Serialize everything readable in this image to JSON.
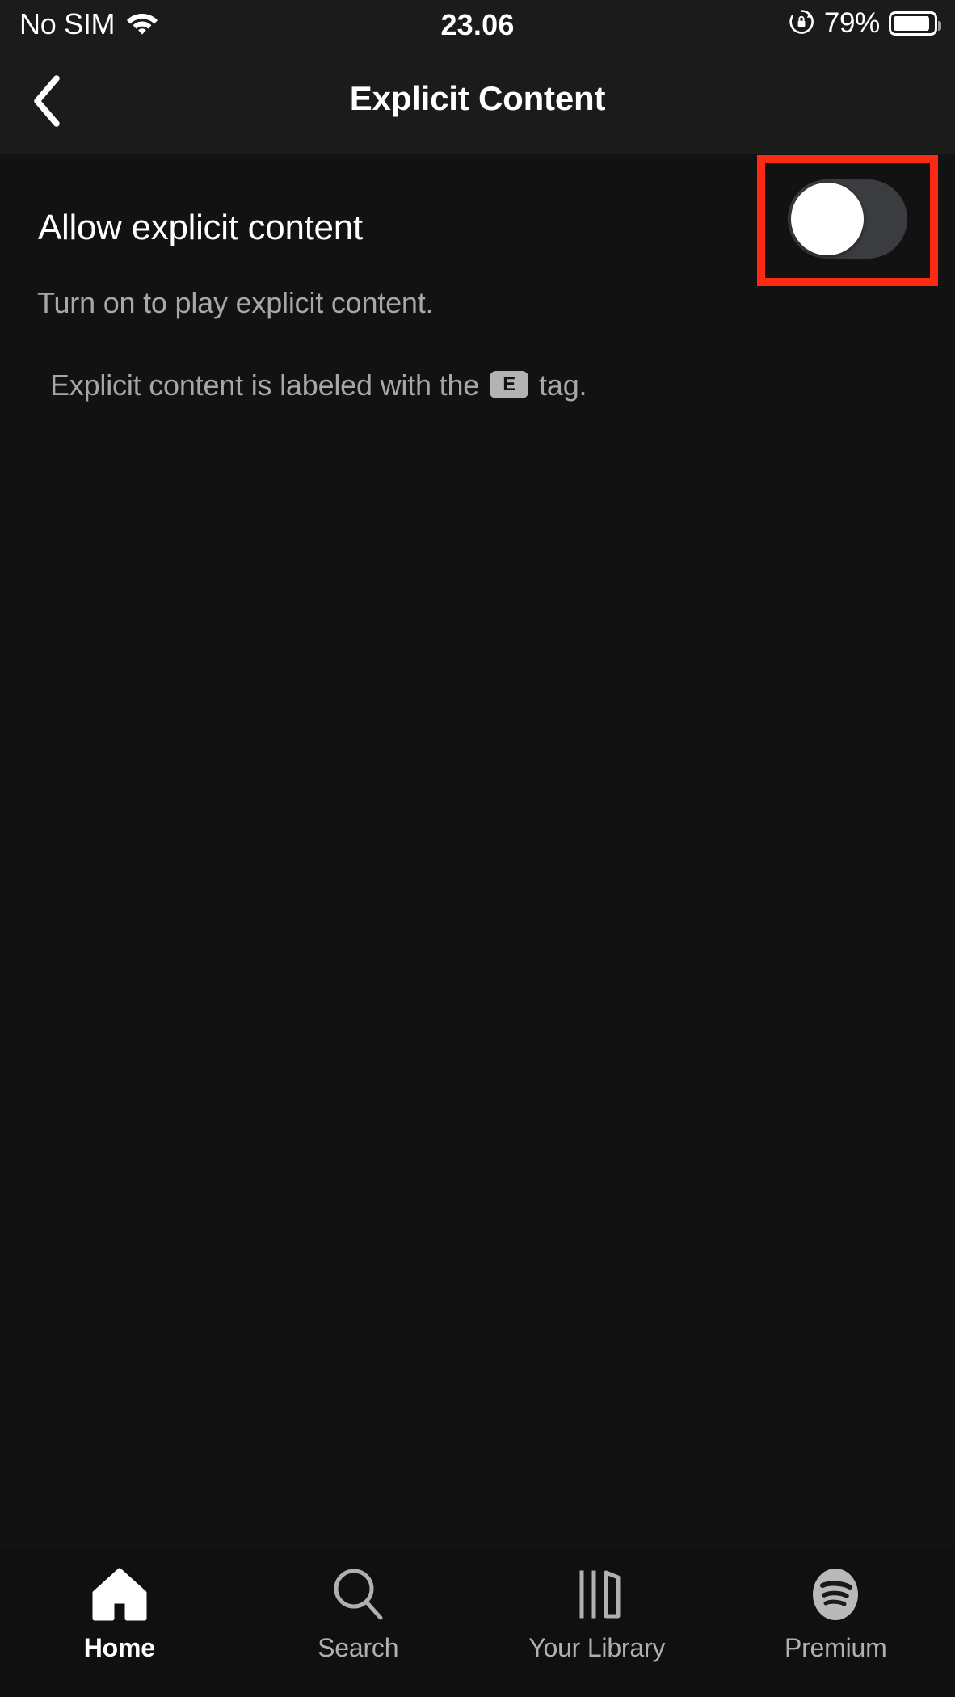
{
  "status_bar": {
    "carrier": "No SIM",
    "wifi_icon": "wifi-icon",
    "time": "23.06",
    "rotation_lock_icon": "rotation-lock-icon",
    "battery_percent": "79%",
    "battery_icon": "battery-icon"
  },
  "nav": {
    "back_icon": "chevron-left-icon",
    "title": "Explicit Content"
  },
  "setting": {
    "label": "Allow explicit content",
    "toggle_state": "off",
    "toggle_name": "allow-explicit-content-toggle",
    "description_line1": "Turn on to play explicit content.",
    "description_line2_before": "Explicit content is labeled with the",
    "explicit_badge": "E",
    "description_line2_after": "tag."
  },
  "highlight": {
    "color": "#fc2a13",
    "target": "allow-explicit-content-toggle"
  },
  "tabbar": {
    "items": [
      {
        "label": "Home",
        "icon": "home-icon",
        "active": true
      },
      {
        "label": "Search",
        "icon": "search-icon",
        "active": false
      },
      {
        "label": "Your Library",
        "icon": "library-icon",
        "active": false
      },
      {
        "label": "Premium",
        "icon": "spotify-icon",
        "active": false
      }
    ]
  },
  "colors": {
    "background": "#121212",
    "header": "#1b1b1b",
    "accent_highlight": "#fc2a13",
    "text_primary": "#ffffff",
    "text_secondary": "#a7a7a7",
    "toggle_track_off": "#3a3c3f",
    "toggle_knob": "#ffffff"
  }
}
